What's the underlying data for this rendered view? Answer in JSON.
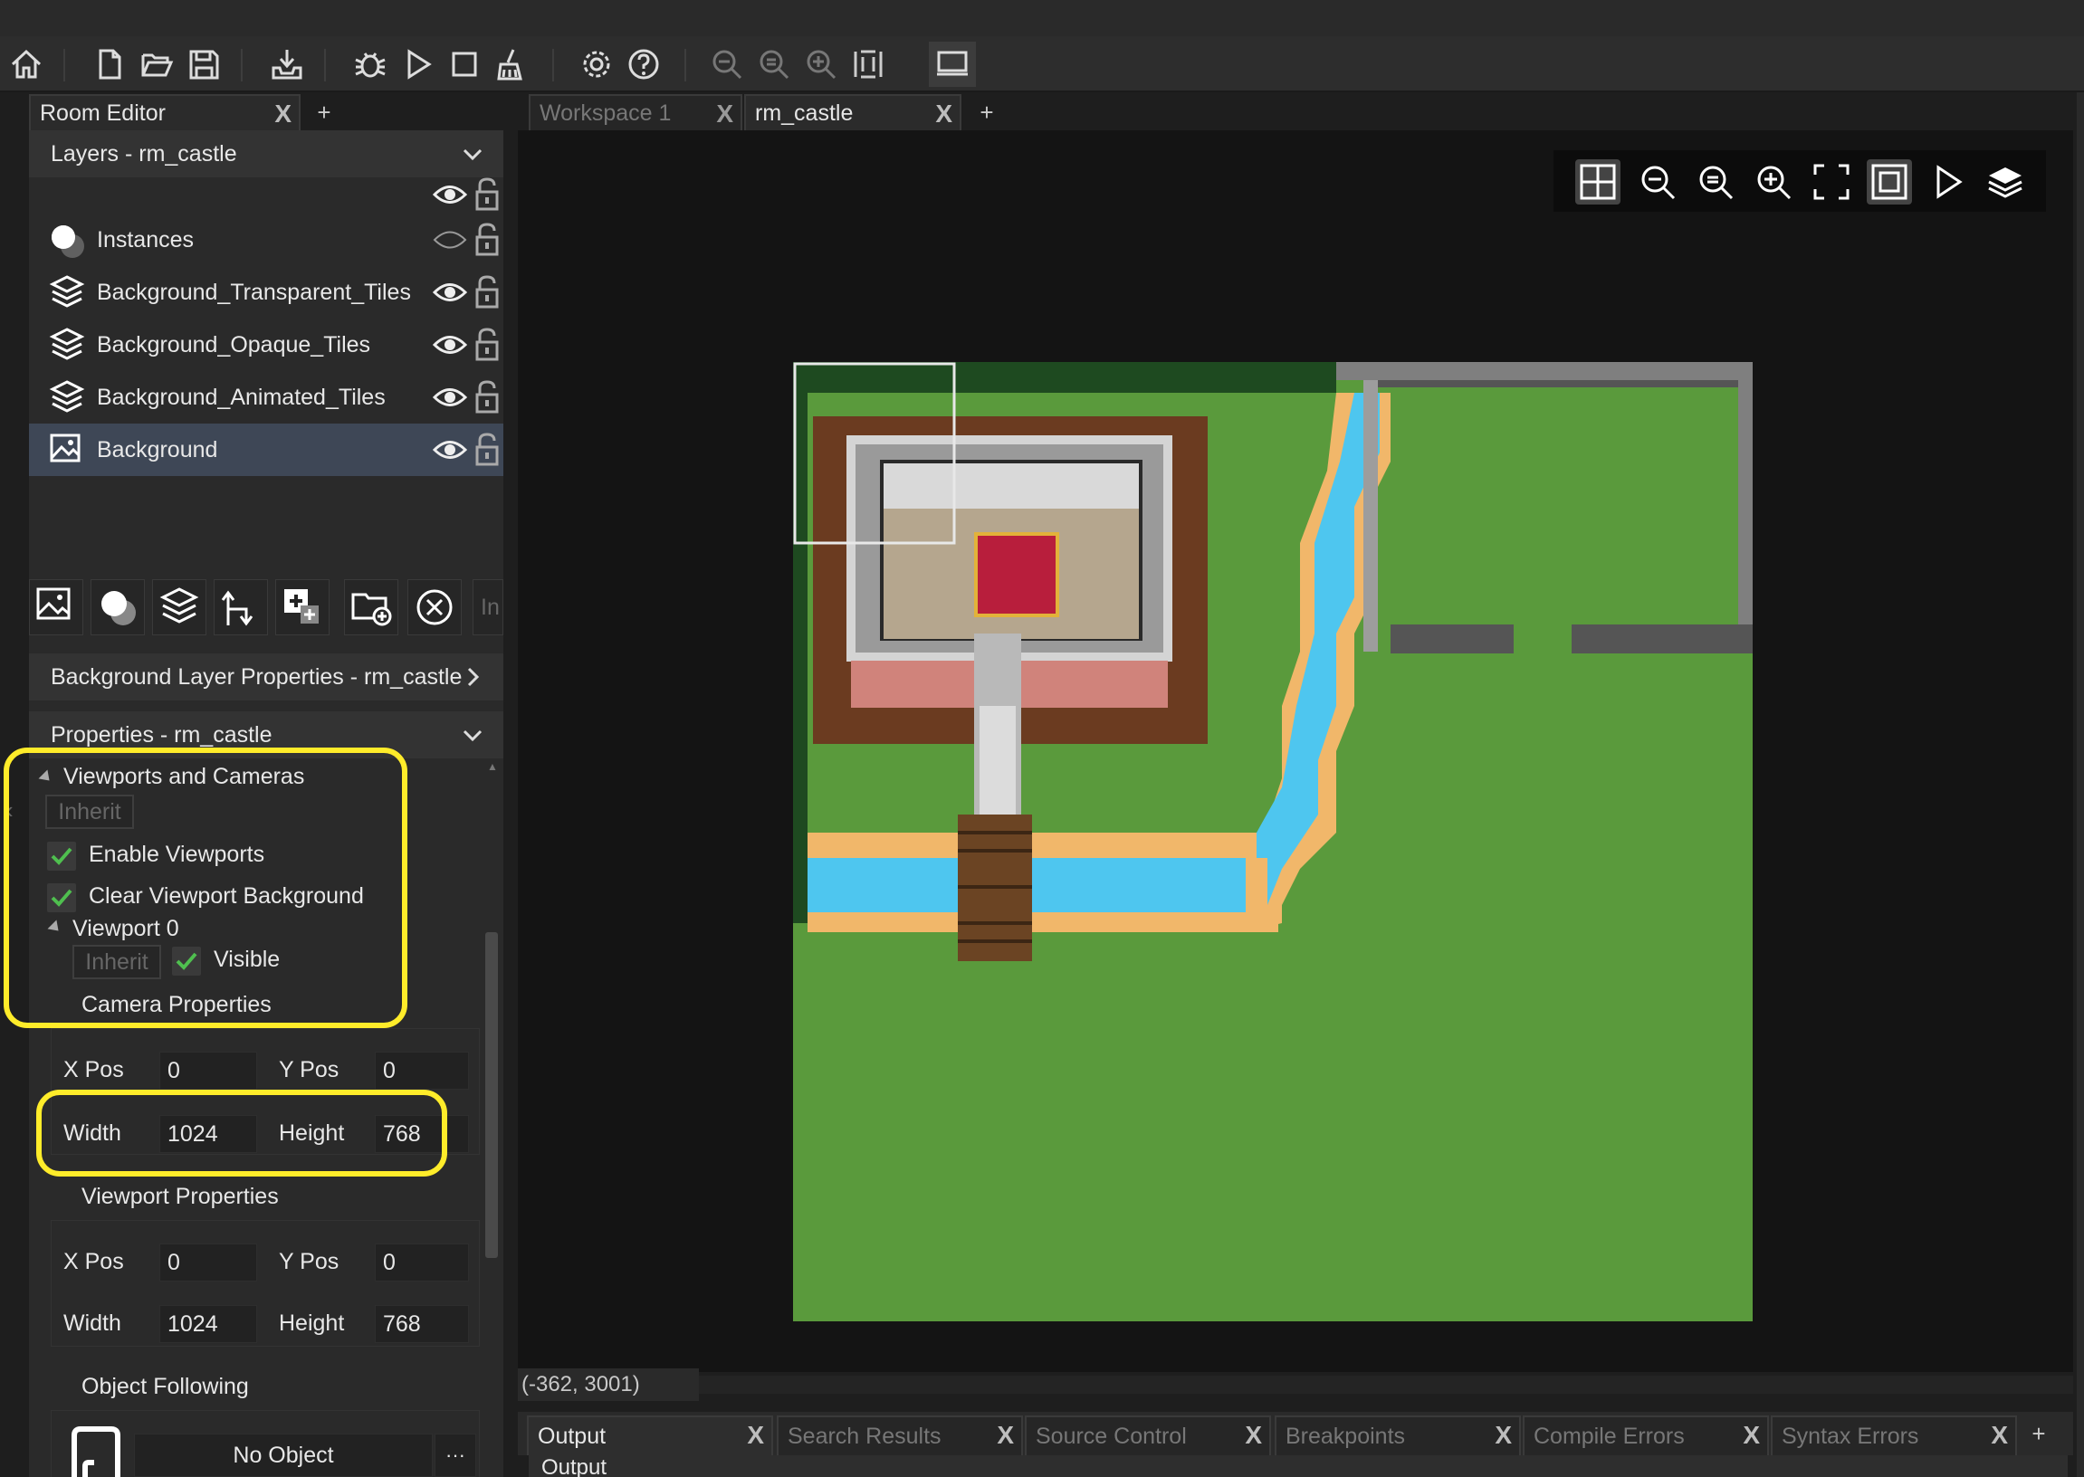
{
  "toolbar": {
    "icons": [
      "home-icon",
      "new-file-icon",
      "open-folder-icon",
      "save-icon",
      "export-icon",
      "debug-icon",
      "run-icon",
      "stop-icon",
      "clean-icon",
      "settings-icon",
      "help-icon",
      "zoom-out-icon",
      "zoom-reset-icon",
      "zoom-in-icon",
      "fit-icon",
      "room-view-icon"
    ]
  },
  "left_tabs": {
    "room_editor": "Room Editor",
    "close": "X",
    "add": "+"
  },
  "layers_panel": {
    "title": "Layers - rm_castle",
    "items": [
      {
        "label": "Instances",
        "icon": "instance-layer-icon",
        "visible": false
      },
      {
        "label": "Background_Transparent_Tiles",
        "icon": "tile-layer-icon",
        "visible": true
      },
      {
        "label": "Background_Opaque_Tiles",
        "icon": "tile-layer-icon",
        "visible": true
      },
      {
        "label": "Background_Animated_Tiles",
        "icon": "tile-layer-icon",
        "visible": true
      },
      {
        "label": "Background",
        "icon": "background-layer-icon",
        "visible": true,
        "selected": true
      }
    ],
    "partial_tool_label": "In"
  },
  "bg_layer_props": {
    "title": "Background Layer Properties - rm_castle"
  },
  "properties": {
    "title": "Properties - rm_castle",
    "viewports_section": "Viewports and Cameras",
    "inherit": "Inherit",
    "enable_viewports": "Enable Viewports",
    "clear_viewport_bg": "Clear Viewport Background",
    "viewport0": "Viewport 0",
    "visible": "Visible",
    "camera_properties": "Camera Properties",
    "camera": {
      "x_label": "X Pos",
      "x": "0",
      "y_label": "Y Pos",
      "y": "0",
      "w_label": "Width",
      "w": "1024",
      "h_label": "Height",
      "h": "768"
    },
    "viewport_properties": "Viewport Properties",
    "viewport": {
      "x_label": "X Pos",
      "x": "0",
      "y_label": "Y Pos",
      "y": "0",
      "w_label": "Width",
      "w": "1024",
      "h_label": "Height",
      "h": "768"
    },
    "object_following": "Object Following",
    "no_object": "No Object",
    "more": "···"
  },
  "workspace_tabs": [
    {
      "label": "Workspace 1",
      "active": false
    },
    {
      "label": "rm_castle",
      "active": true
    }
  ],
  "status": {
    "coords": "(-362, 3001)"
  },
  "output_tabs": [
    "Output",
    "Search Results",
    "Source Control",
    "Breakpoints",
    "Compile Errors",
    "Syntax Errors"
  ],
  "output_header": "Output",
  "colors": {
    "highlight": "#ffec2a",
    "grass": "#5d9a3e",
    "water": "#4ec6ef",
    "sand": "#f1b76a",
    "accent_check": "#4fbf4f"
  }
}
